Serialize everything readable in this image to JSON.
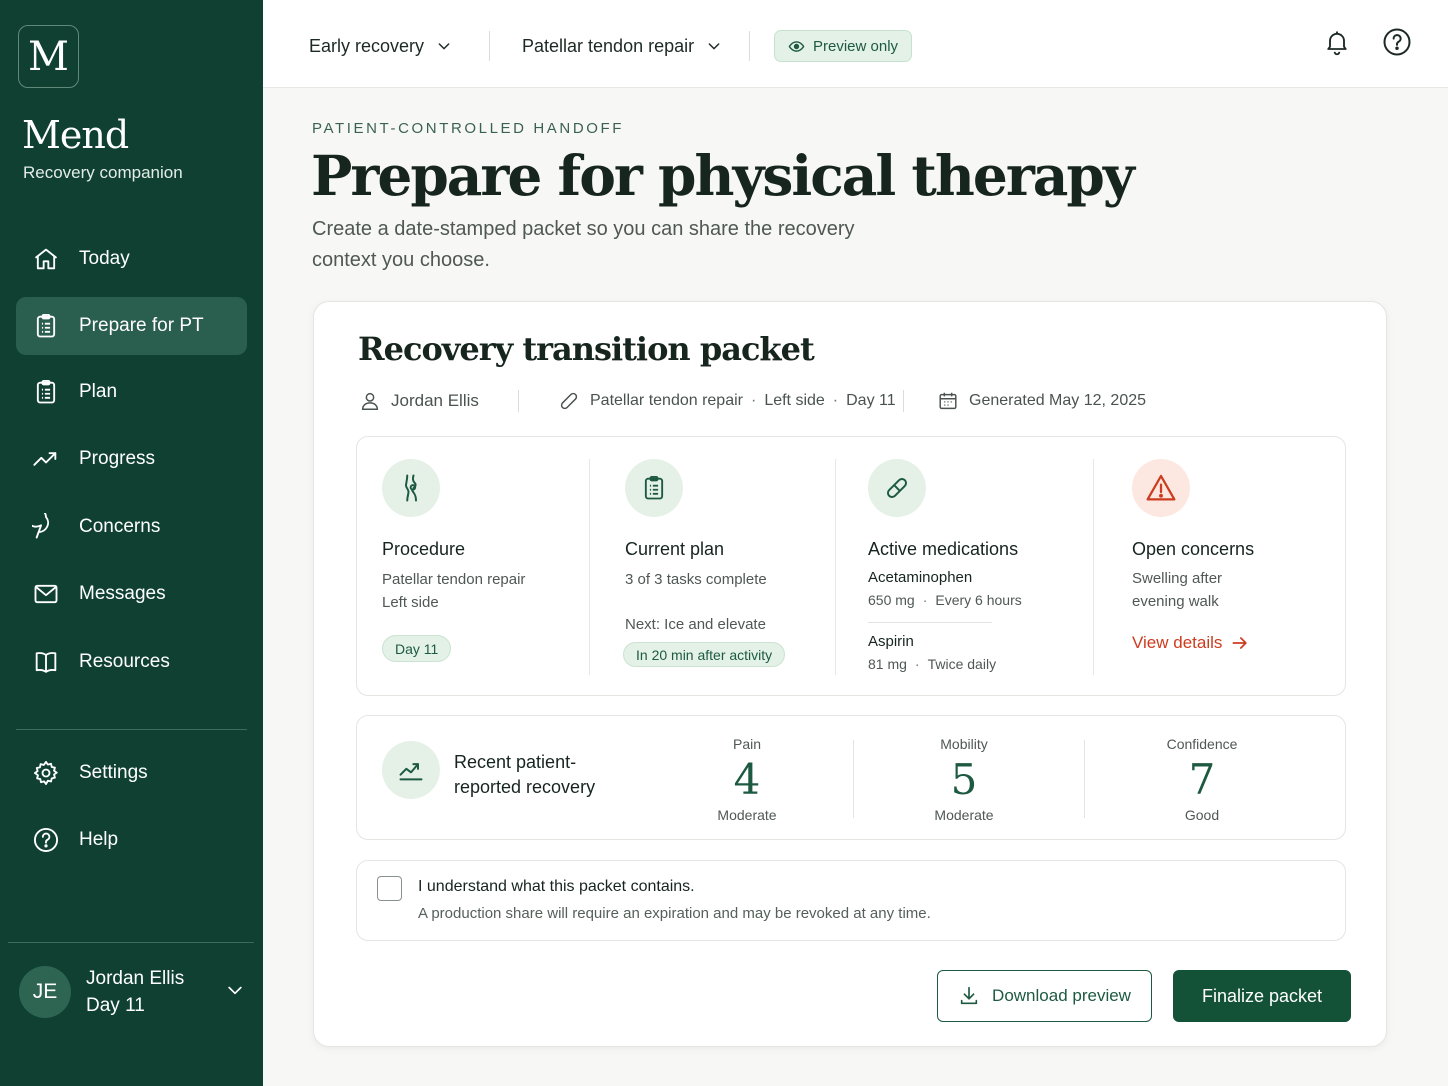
{
  "brand": {
    "logo_letter": "M",
    "name": "Mend",
    "tagline": "Recovery companion"
  },
  "nav": {
    "items": [
      {
        "label": "Today",
        "icon": "home-icon"
      },
      {
        "label": "Prepare for PT",
        "icon": "clipboard-icon",
        "active": true
      },
      {
        "label": "Plan",
        "icon": "checklist-icon"
      },
      {
        "label": "Progress",
        "icon": "trend-icon"
      },
      {
        "label": "Concerns",
        "icon": "chat-bubble-icon"
      },
      {
        "label": "Messages",
        "icon": "mail-icon"
      },
      {
        "label": "Resources",
        "icon": "book-icon"
      }
    ],
    "secondary": [
      {
        "label": "Settings",
        "icon": "gear-icon"
      },
      {
        "label": "Help",
        "icon": "help-icon"
      }
    ]
  },
  "user": {
    "initials": "JE",
    "name": "Jordan Ellis",
    "day": "Day 11"
  },
  "topbar": {
    "phase": "Early recovery",
    "procedure": "Patellar tendon repair",
    "preview_badge": "Preview only"
  },
  "page": {
    "eyebrow": "PATIENT-CONTROLLED HANDOFF",
    "title": "Prepare for physical therapy",
    "description": "Create a date-stamped packet so you can share the recovery context you choose."
  },
  "packet": {
    "title": "Recovery transition packet",
    "patient": "Jordan Ellis",
    "procedure": "Patellar tendon repair",
    "side": "Left side",
    "day": "Day 11",
    "generated": "Generated May 12, 2025",
    "summary": {
      "procedure": {
        "title": "Procedure",
        "line1": "Patellar tendon repair",
        "line2": "Left side",
        "badge": "Day 11"
      },
      "plan": {
        "title": "Current plan",
        "progress": "3 of 3 tasks complete",
        "next": "Next: Ice and elevate",
        "badge": "In 20 min after activity"
      },
      "medications": {
        "title": "Active medications",
        "items": [
          {
            "name": "Acetaminophen",
            "dose": "650 mg",
            "freq": "Every 6 hours"
          },
          {
            "name": "Aspirin",
            "dose": "81 mg",
            "freq": "Twice daily"
          }
        ]
      },
      "concerns": {
        "title": "Open concerns",
        "line1": "Swelling after",
        "line2": "evening walk",
        "link": "View details"
      }
    },
    "recovery": {
      "title": "Recent patient-reported recovery",
      "scores": [
        {
          "label": "Pain",
          "value": "4",
          "desc": "Moderate"
        },
        {
          "label": "Mobility",
          "value": "5",
          "desc": "Moderate"
        },
        {
          "label": "Confidence",
          "value": "7",
          "desc": "Good"
        }
      ]
    },
    "acknowledge": {
      "checked": false,
      "title": "I understand what this packet contains.",
      "subtitle": "A production share will require an expiration and may be revoked at any time."
    },
    "actions": {
      "download": "Download preview",
      "finalize": "Finalize packet"
    }
  },
  "colors": {
    "sidebar": "#0f4032",
    "accent": "#1e5a42",
    "warning": "#cd3c1f"
  }
}
